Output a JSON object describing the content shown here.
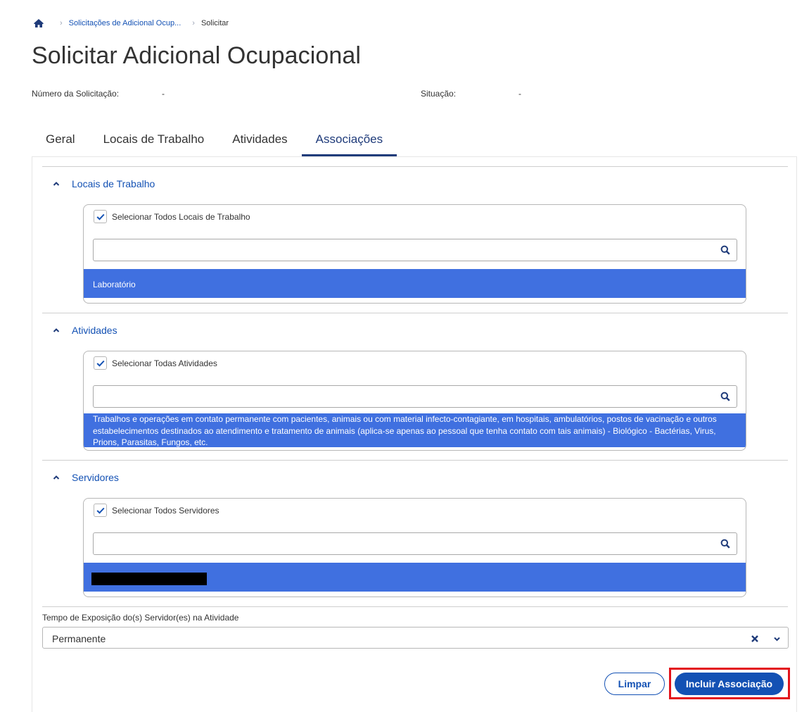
{
  "breadcrumb": {
    "home_icon": "home-icon",
    "separator_icon": "chevron-right-icon",
    "items": [
      "Solicitações de Adicional Ocup...",
      "Solicitar"
    ]
  },
  "page": {
    "title": "Solicitar Adicional Ocupacional",
    "request_number_label": "Número da Solicitação:",
    "request_number_value": "-",
    "status_label": "Situação:",
    "status_value": "-"
  },
  "tabs": [
    {
      "label": "Geral",
      "active": false
    },
    {
      "label": "Locais de Trabalho",
      "active": false
    },
    {
      "label": "Atividades",
      "active": false
    },
    {
      "label": "Associações",
      "active": true
    }
  ],
  "sections": {
    "locais": {
      "title": "Locais de Trabalho",
      "expanded": true,
      "select_all_label": "Selecionar Todos Locais de Trabalho",
      "select_all_checked": true,
      "search_value": "",
      "selected_item": "Laboratório"
    },
    "atividades": {
      "title": "Atividades",
      "expanded": true,
      "select_all_label": "Selecionar Todas Atividades",
      "select_all_checked": true,
      "search_value": "",
      "selected_item": "Trabalhos e operações em contato permanente com pacientes, animais ou com material infecto-contagiante, em hospitais, ambulatórios, postos de vacinação e outros estabelecimentos destinados ao atendimento e tratamento de animais (aplica-se apenas ao pessoal que tenha contato com tais animais) - Biológico - Bactérias, Virus, Prions, Parasitas, Fungos, etc."
    },
    "servidores": {
      "title": "Servidores",
      "expanded": true,
      "select_all_label": "Selecionar Todos Servidores",
      "select_all_checked": true,
      "search_value": "",
      "selected_item_redacted": true
    }
  },
  "exposure": {
    "label": "Tempo de Exposição do(s) Servidor(es) na Atividade",
    "value": "Permanente"
  },
  "actions": {
    "clear_label": "Limpar",
    "submit_label": "Incluir Associação"
  },
  "colors": {
    "primary": "#1351b4",
    "selected_row": "#4070e0",
    "tab_active": "#1f3b7a",
    "highlight": "#e3131b"
  }
}
